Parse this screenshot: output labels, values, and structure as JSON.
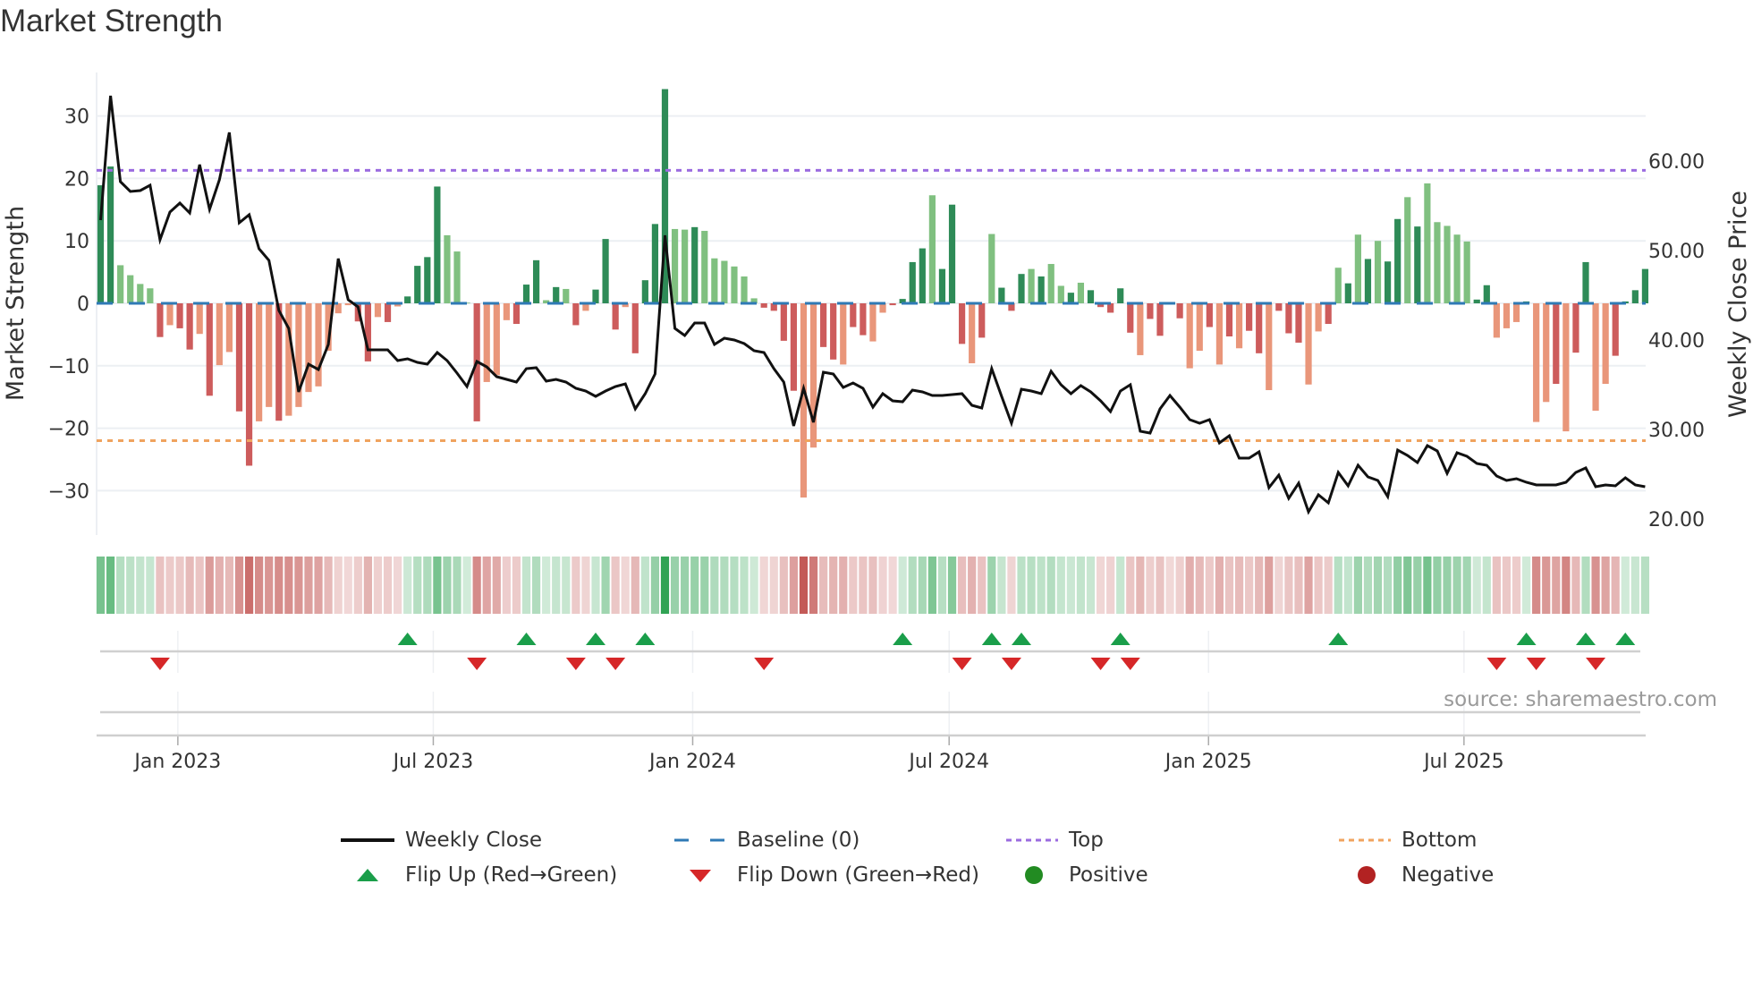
{
  "title": "Market Strength",
  "source": "source: sharemaestro.com",
  "colors": {
    "strong_green": "#2e8b57",
    "light_green": "#80c080",
    "strong_red": "#cd5c5c",
    "light_red": "#e9967a",
    "close_line": "#111111",
    "baseline": "#2f7ab5",
    "top": "#9b6be0",
    "bottom": "#f0a35e",
    "flip_up": "#1a9e4a",
    "flip_down": "#d62728",
    "positive": "#228b22",
    "negative": "#b22222",
    "heat_green": "#31a354",
    "heat_red": "#c0504d"
  },
  "legend": [
    {
      "key": "weekly_close",
      "label": "Weekly Close"
    },
    {
      "key": "baseline",
      "label": "Baseline (0)"
    },
    {
      "key": "top",
      "label": "Top"
    },
    {
      "key": "bottom",
      "label": "Bottom"
    },
    {
      "key": "flip_up",
      "label": "Flip Up (Red→Green)"
    },
    {
      "key": "flip_down",
      "label": "Flip Down (Green→Red)"
    },
    {
      "key": "positive",
      "label": "Positive"
    },
    {
      "key": "negative",
      "label": "Negative"
    }
  ],
  "chart_data": {
    "type": "bar",
    "title": "Market Strength",
    "ylabel": "Market Strength",
    "y2label": "Weekly Close Price",
    "ylim": [
      -37.5,
      36.7
    ],
    "y2lim": [
      18.1,
      70.9
    ],
    "yticks": [
      {
        "value": 30,
        "label": "30"
      },
      {
        "value": 20,
        "label": "20"
      },
      {
        "value": 10,
        "label": "10"
      },
      {
        "value": 0,
        "label": "0"
      },
      {
        "value": -10,
        "label": "−10"
      },
      {
        "value": -20,
        "label": "−20"
      },
      {
        "value": -30,
        "label": "−30"
      }
    ],
    "y2ticks": [
      {
        "value": 60,
        "label": "60.00"
      },
      {
        "value": 50,
        "label": "50.00"
      },
      {
        "value": 40,
        "label": "40.00"
      },
      {
        "value": 30,
        "label": "30.00"
      },
      {
        "value": 20,
        "label": "20.00"
      }
    ],
    "xticks": [
      {
        "week": 7.8,
        "label": "Jan 2023"
      },
      {
        "week": 33.6,
        "label": "Jul 2023"
      },
      {
        "week": 59.8,
        "label": "Jan 2024"
      },
      {
        "week": 85.7,
        "label": "Jul 2024"
      },
      {
        "week": 111.9,
        "label": "Jan 2025"
      },
      {
        "week": 137.7,
        "label": "Jul 2025"
      }
    ],
    "top_level": 21.3,
    "bottom_level": -22.0,
    "baseline": 0,
    "strength": [
      18.9,
      21.9,
      6.1,
      4.5,
      3.1,
      2.4,
      -5.4,
      -3.5,
      -4.0,
      -7.4,
      -4.9,
      -14.8,
      -9.9,
      -7.8,
      -17.3,
      -26.0,
      -18.9,
      -16.6,
      -18.8,
      -18.0,
      -16.6,
      -14.2,
      -13.3,
      -7.6,
      -1.6,
      -0.3,
      -2.9,
      -9.3,
      -2.2,
      -3.0,
      -0.5,
      1.1,
      6.0,
      7.4,
      18.7,
      10.9,
      8.3,
      0.1,
      -18.9,
      -12.6,
      -11.5,
      -2.7,
      -3.3,
      3.0,
      6.9,
      0.5,
      2.6,
      2.3,
      -3.5,
      -1.2,
      2.2,
      10.3,
      -4.2,
      -0.6,
      -8.0,
      3.7,
      12.7,
      34.3,
      11.9,
      11.8,
      12.2,
      11.6,
      7.2,
      6.8,
      5.9,
      4.3,
      0.8,
      -0.7,
      -1.2,
      -6.0,
      -14.0,
      -31.1,
      -23.1,
      -7.0,
      -9.0,
      -9.8,
      -3.8,
      -5.1,
      -6.1,
      -1.5,
      -0.3,
      0.7,
      6.6,
      8.8,
      17.3,
      5.5,
      15.8,
      -6.5,
      -9.6,
      -5.5,
      11.1,
      2.5,
      -1.2,
      4.7,
      5.5,
      4.3,
      6.3,
      2.8,
      1.7,
      3.3,
      2.1,
      -0.6,
      -1.5,
      2.4,
      -4.7,
      -8.3,
      -2.5,
      -5.2,
      -0.1,
      -2.4,
      -10.4,
      -7.6,
      -3.8,
      -9.8,
      -5.3,
      -7.2,
      -4.4,
      -8.0,
      -13.9,
      -1.2,
      -4.8,
      -6.3,
      -13.0,
      -4.5,
      -3.3,
      5.7,
      3.2,
      11.0,
      7.1,
      10.0,
      6.7,
      13.5,
      17.0,
      12.3,
      19.2,
      13.0,
      12.4,
      11.0,
      9.9,
      0.6,
      2.9,
      -5.5,
      -4.0,
      -3.0,
      0.3,
      -19.0,
      -15.8,
      -12.9,
      -20.5,
      -7.9,
      6.6,
      -17.2,
      -12.9,
      -8.4,
      0.3,
      2.1,
      5.5
    ],
    "shade": "ddlllldlddldllddlldlllllllddldlddddllldllldddldldldddlddddlldllllllddddlldd lddllddddldddldldddldlldldddddlddldlldldlddldddlldldldlddldllllldd llldlldlddlldddd",
    "weekly_close": [
      53.4,
      67.3,
      57.7,
      56.6,
      56.7,
      57.3,
      51.2,
      54.3,
      55.3,
      54.2,
      59.6,
      54.6,
      57.9,
      63.2,
      53.1,
      54.0,
      50.2,
      48.9,
      43.3,
      41.3,
      34.2,
      37.3,
      36.7,
      39.5,
      49.1,
      44.5,
      43.7,
      38.9,
      38.9,
      38.9,
      37.7,
      37.9,
      37.5,
      37.3,
      38.6,
      37.7,
      36.3,
      34.8,
      37.6,
      37.0,
      35.9,
      35.6,
      35.3,
      36.8,
      36.9,
      35.4,
      35.6,
      35.3,
      34.6,
      34.3,
      33.7,
      34.3,
      34.8,
      35.1,
      32.3,
      34.0,
      36.2,
      51.7,
      41.3,
      40.5,
      41.9,
      41.9,
      39.5,
      40.2,
      40.0,
      39.6,
      38.8,
      38.6,
      36.8,
      35.3,
      30.4,
      34.6,
      30.8,
      36.4,
      36.2,
      34.7,
      35.2,
      34.6,
      32.5,
      34.0,
      33.2,
      33.1,
      34.4,
      34.2,
      33.8,
      33.8,
      33.9,
      34.0,
      32.7,
      32.4,
      36.8,
      33.7,
      30.7,
      34.5,
      34.3,
      34.0,
      36.5,
      35.0,
      34.0,
      34.9,
      34.2,
      33.2,
      32.0,
      34.3,
      35.0,
      29.8,
      29.6,
      32.3,
      33.8,
      32.5,
      31.1,
      30.7,
      31.1,
      28.5,
      29.3,
      26.8,
      26.8,
      27.5,
      23.5,
      24.9,
      22.3,
      24.0,
      20.8,
      22.7,
      21.8,
      25.2,
      23.7,
      26.0,
      24.7,
      24.3,
      22.5,
      27.7,
      27.1,
      26.3,
      28.2,
      27.6,
      25.1,
      27.4,
      27.0,
      26.2,
      26.0,
      24.8,
      24.3,
      24.5,
      24.1,
      23.8,
      23.8,
      23.8,
      24.1,
      25.2,
      25.7,
      23.6,
      23.8,
      23.7,
      24.6,
      23.8,
      23.6
    ],
    "flip_up_weeks": [
      32,
      44,
      51,
      56,
      82,
      91,
      94,
      104,
      126,
      145,
      151,
      155
    ],
    "flip_down_weeks": [
      7,
      39,
      49,
      53,
      68,
      88,
      93,
      102,
      105,
      142,
      146,
      152
    ]
  }
}
